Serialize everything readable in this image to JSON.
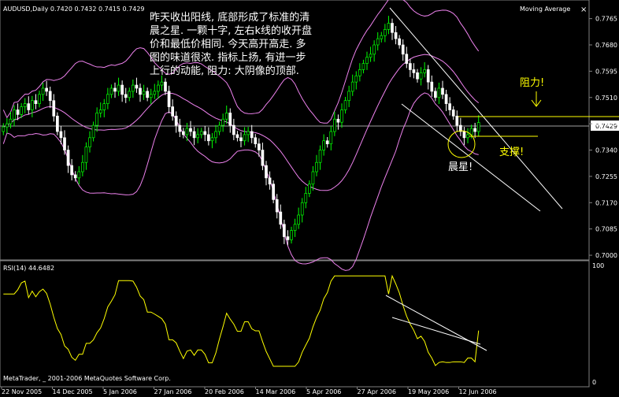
{
  "window": {
    "symbol_header": "AUDUSD,Daily  0.7420 0.7432 0.7415 0.7429",
    "indicator_title": "Moving Average",
    "close_glyph": "×",
    "rsi_header": "RSI(14) 44.6482",
    "copyright": "MetaTrader, _ 2001-2006 MetaQuotes Software Corp.",
    "last_price_tag": "0.7429"
  },
  "annotations": {
    "commentary_lines": [
      "昨天收出阳线, 底部形成了标准的清",
      "晨之星. 一颗十字, 左右k线的收开盘",
      "价和最低价相同. 今天高开高走. 多",
      "图的味道很浓. 指标上扬, 有进一步",
      "上行的动能, 阻力: 大阴像的顶部."
    ],
    "resistance_label": "阻力!",
    "support_label": "支撑!",
    "morning_star_label": "晨星!"
  },
  "colors": {
    "background": "#000000",
    "bull_candle": "#00ff00",
    "bear_candle": "#ffffff",
    "bands": "#ee82ee",
    "rsi_line": "#ffff00",
    "annotation": "#ffff00",
    "text": "#ffffff",
    "grid": "#808080",
    "price_line": "#a0a0a0"
  },
  "chart_data": {
    "type": "candlestick",
    "symbol": "AUDUSD",
    "timeframe": "Daily",
    "ohlc_last": {
      "open": 0.742,
      "high": 0.7432,
      "low": 0.7415,
      "close": 0.7429
    },
    "price_axis": {
      "ticks": [
        "0.7765",
        "0.7680",
        "0.7595",
        "0.7510",
        "0.7425",
        "0.7340",
        "0.7255",
        "0.7170",
        "0.7085",
        "0.7000"
      ],
      "ylim": [
        0.6995,
        0.7815
      ]
    },
    "date_axis": {
      "labels": [
        "22 Nov 2005",
        "14 Dec 2005",
        "5 Jan 2006",
        "27 Jan 2006",
        "20 Feb 2006",
        "14 Mar 2006",
        "5 Apr 2006",
        "27 Apr 2006",
        "19 May 2006",
        "12 Jun 2006"
      ]
    },
    "candles_close": [
      0.7415,
      0.7425,
      0.744,
      0.747,
      0.7455,
      0.748,
      0.749,
      0.747,
      0.75,
      0.749,
      0.752,
      0.754,
      0.753,
      0.75,
      0.745,
      0.74,
      0.738,
      0.734,
      0.729,
      0.726,
      0.725,
      0.727,
      0.73,
      0.735,
      0.738,
      0.742,
      0.746,
      0.747,
      0.749,
      0.752,
      0.754,
      0.753,
      0.755,
      0.752,
      0.751,
      0.753,
      0.755,
      0.754,
      0.752,
      0.753,
      0.751,
      0.752,
      0.753,
      0.755,
      0.756,
      0.753,
      0.748,
      0.745,
      0.742,
      0.74,
      0.739,
      0.741,
      0.74,
      0.738,
      0.739,
      0.74,
      0.739,
      0.737,
      0.738,
      0.74,
      0.742,
      0.744,
      0.746,
      0.742,
      0.739,
      0.738,
      0.737,
      0.739,
      0.74,
      0.738,
      0.736,
      0.734,
      0.729,
      0.725,
      0.723,
      0.718,
      0.714,
      0.71,
      0.706,
      0.705,
      0.708,
      0.71,
      0.713,
      0.717,
      0.72,
      0.723,
      0.727,
      0.73,
      0.734,
      0.737,
      0.736,
      0.74,
      0.744,
      0.743,
      0.747,
      0.75,
      0.753,
      0.756,
      0.758,
      0.76,
      0.762,
      0.764,
      0.765,
      0.768,
      0.77,
      0.771,
      0.773,
      0.775,
      0.772,
      0.77,
      0.768,
      0.765,
      0.762,
      0.76,
      0.759,
      0.757,
      0.759,
      0.76,
      0.756,
      0.753,
      0.751,
      0.754,
      0.752,
      0.749,
      0.747,
      0.745,
      0.742,
      0.74,
      0.738,
      0.739,
      0.741,
      0.74,
      0.7429
    ],
    "indicators": [
      {
        "name": "Bollinger Bands",
        "type": "band"
      },
      {
        "name": "RSI(14)",
        "last_value": 44.6482,
        "ylim": [
          0,
          100
        ],
        "ticks": [
          "100",
          "0"
        ]
      }
    ]
  }
}
